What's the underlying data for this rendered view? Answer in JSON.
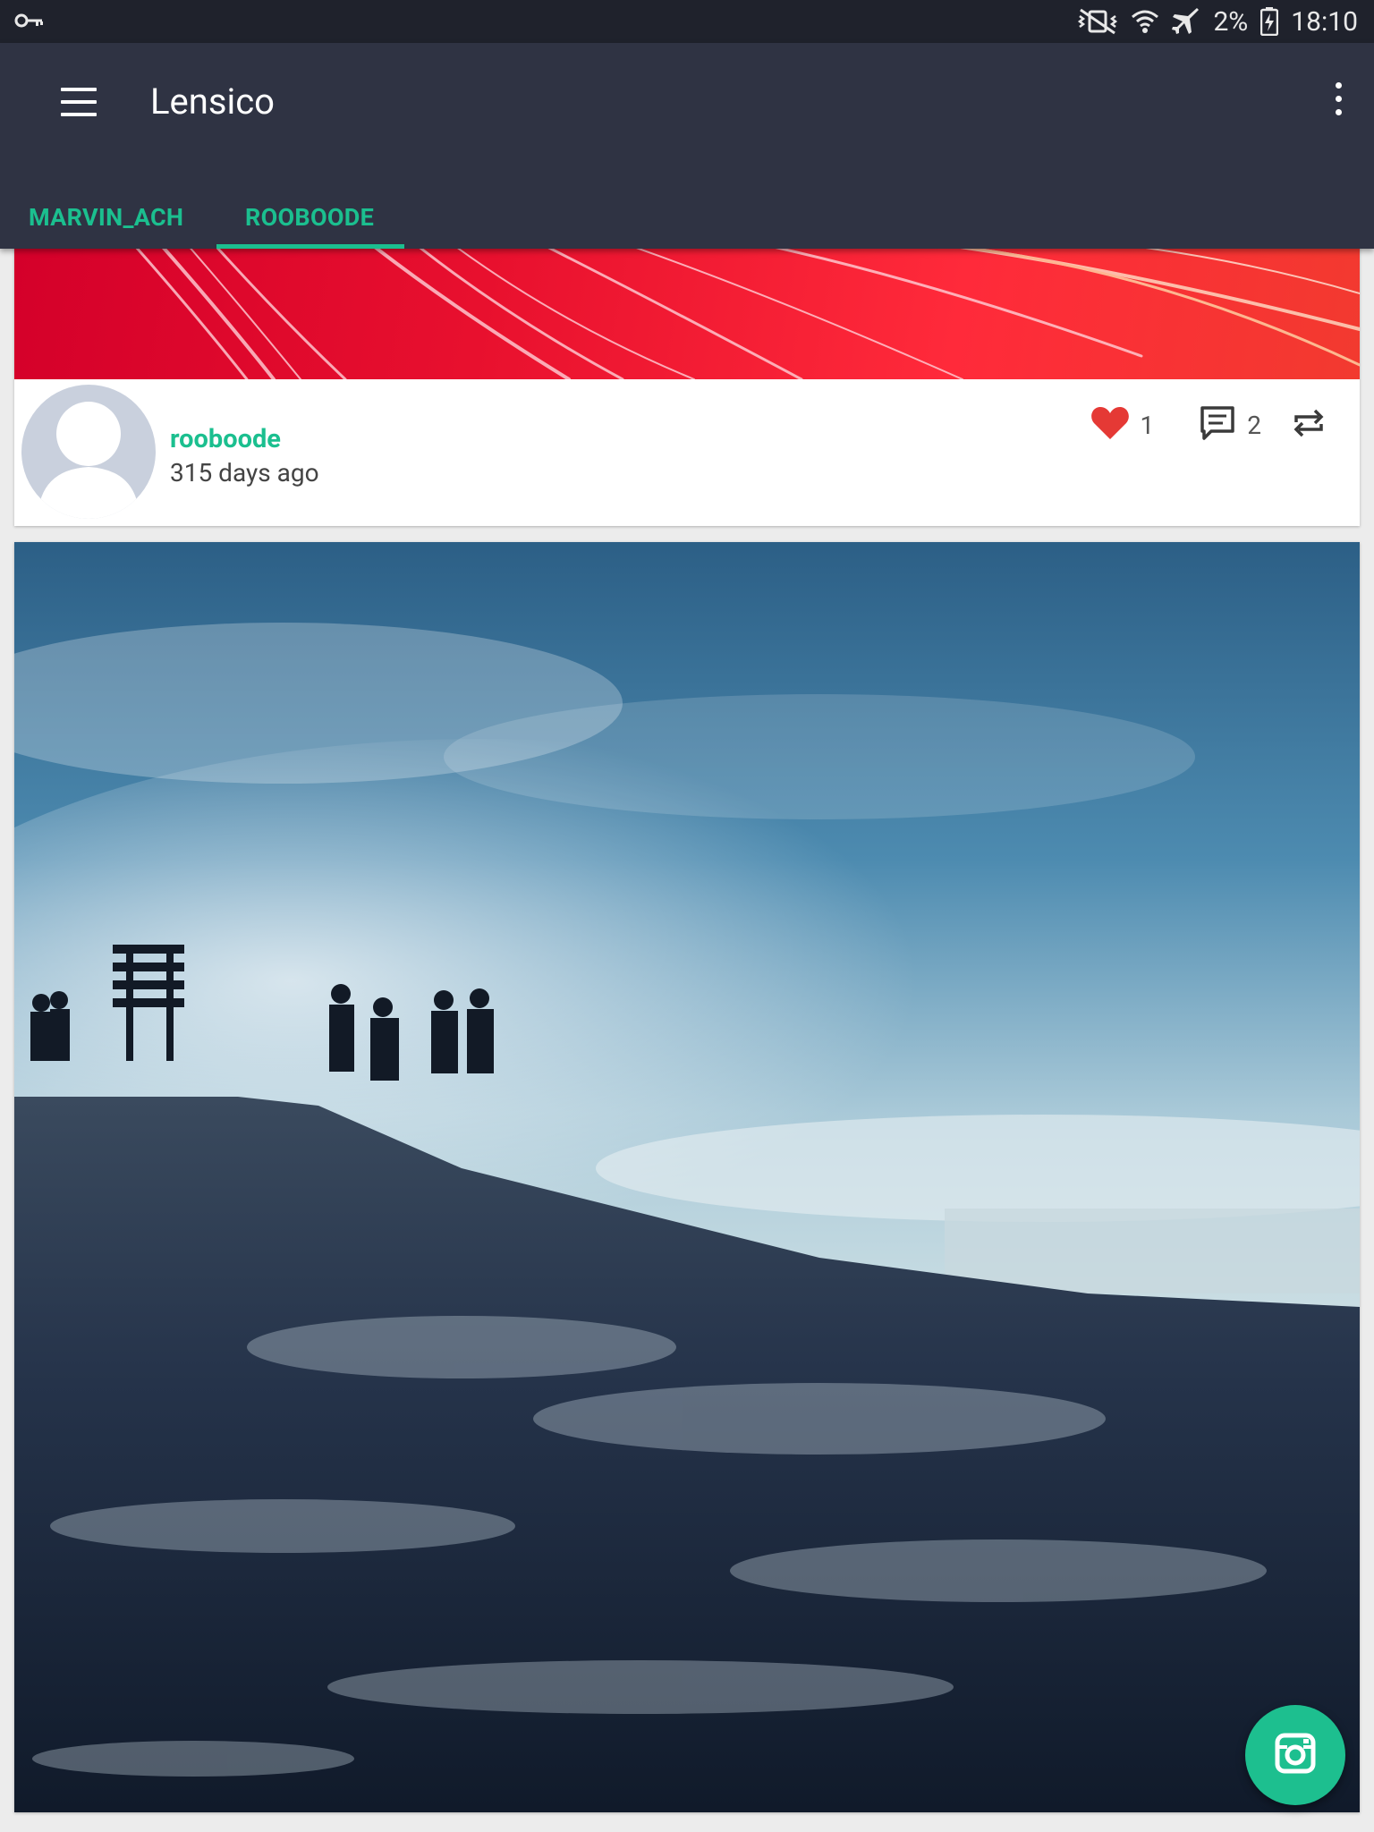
{
  "status_bar": {
    "battery": "2%",
    "time": "18:10",
    "icons": [
      "key-icon",
      "vibrate-mute-icon",
      "wifi-icon",
      "airplane-icon",
      "battery-charging-icon"
    ]
  },
  "app_bar": {
    "title": "Lensico",
    "menu_icon": "hamburger-menu-icon",
    "overflow_icon": "more-vert-icon"
  },
  "tabs": [
    {
      "label": "MARVIN_ACH",
      "active": false
    },
    {
      "label": "ROOBOODE",
      "active": true
    }
  ],
  "posts": [
    {
      "image": "red-streaks-photo",
      "username": "rooboode",
      "time_ago": "315 days ago",
      "likes": "1",
      "comments": "2",
      "icons": [
        "heart-icon",
        "comment-icon",
        "repost-icon"
      ]
    },
    {
      "image": "mountain-summit-photo"
    }
  ],
  "fab": {
    "icon": "instagram-camera-icon"
  },
  "colors": {
    "status_bar": "#1f222c",
    "app_bar": "#2f3343",
    "accent": "#1bbf8f",
    "heart": "#e53935"
  }
}
